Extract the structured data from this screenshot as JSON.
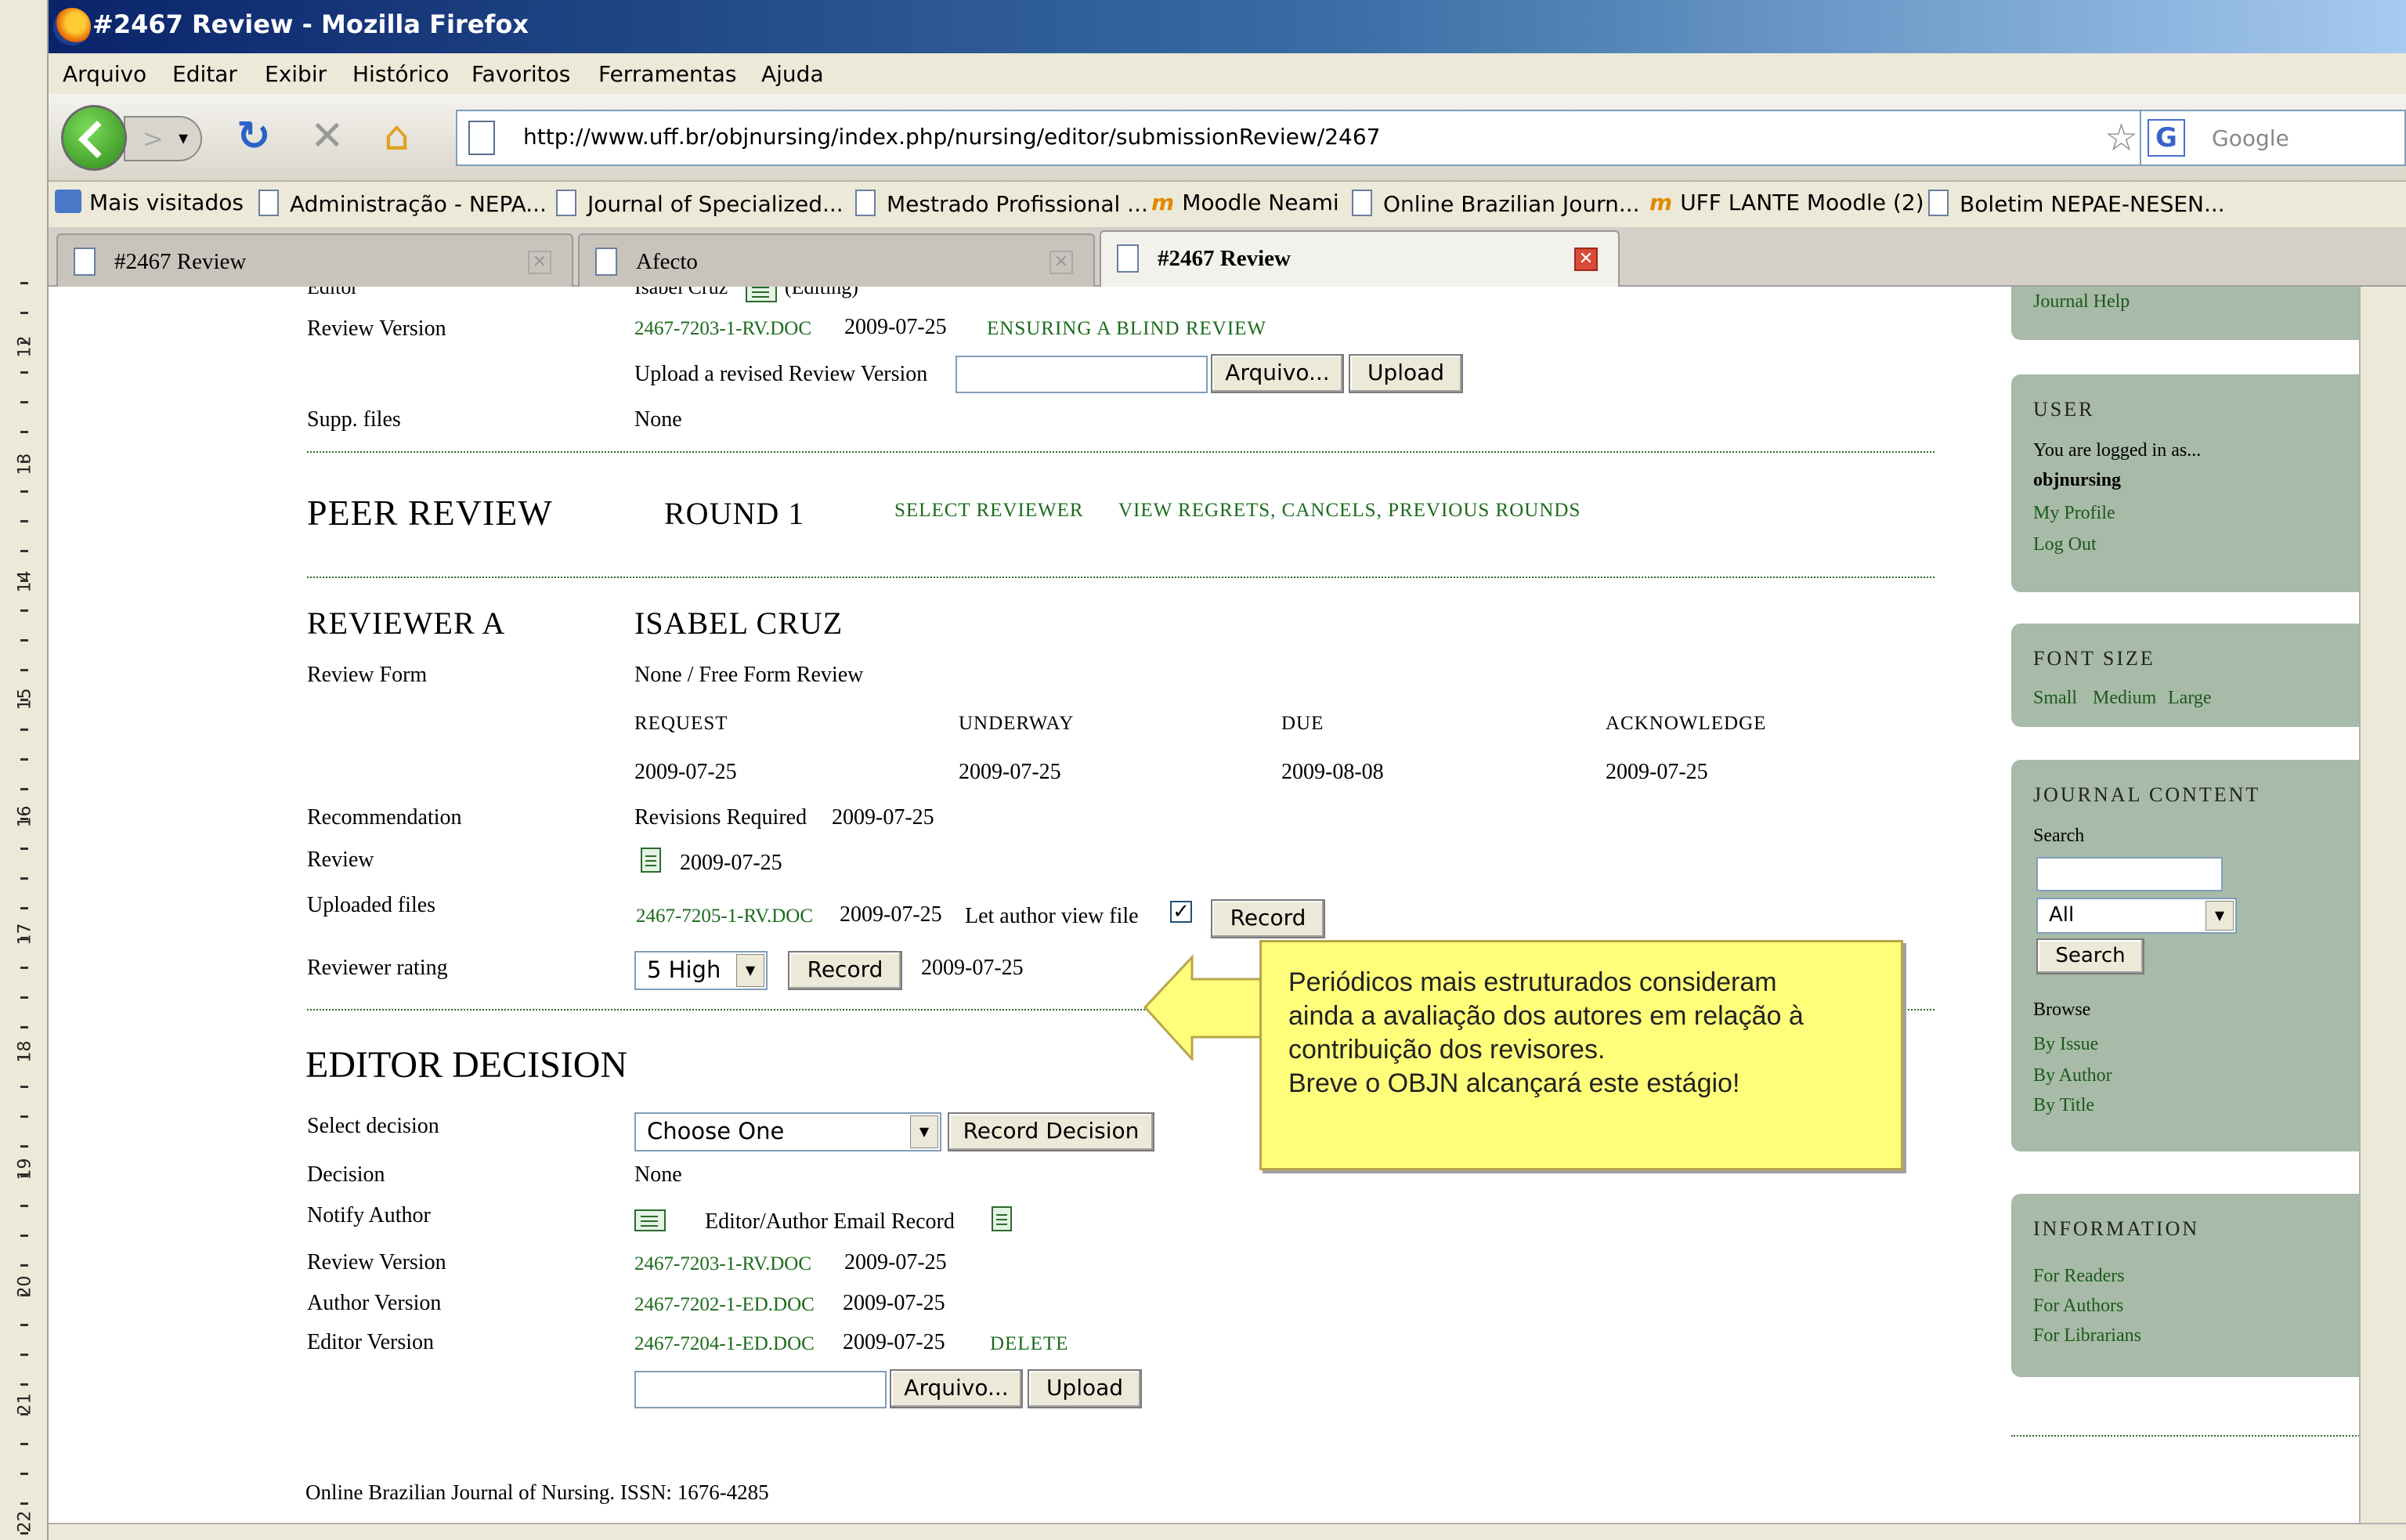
{
  "window": {
    "title": "#2467 Review - Mozilla Firefox"
  },
  "menu": [
    "Arquivo",
    "Editar",
    "Exibir",
    "Histórico",
    "Favoritos",
    "Ferramentas",
    "Ajuda"
  ],
  "nav": {
    "url": "http://www.uff.br/objnursing/index.php/nursing/editor/submissionReview/2467",
    "search_placeholder": "Google"
  },
  "bookmarks": [
    "Mais visitados",
    "Administração - NEPA...",
    "Journal of Specialized...",
    "Mestrado Profissional ...",
    "Moodle Neami",
    "Online Brazilian Journ...",
    "UFF LANTE Moodle (2)",
    "Boletim NEPAE-NESEN..."
  ],
  "tabs": [
    {
      "label": "#2467 Review",
      "active": false
    },
    {
      "label": "Afecto",
      "active": false
    },
    {
      "label": "#2467 Review",
      "active": true
    }
  ],
  "ruler": [
    "12",
    "13",
    "14",
    "15",
    "16",
    "17",
    "18",
    "19",
    "20",
    "21",
    "22"
  ],
  "top_section": {
    "editor_label": "Editor",
    "editor_value": "Isabel Cruz",
    "editor_role": "(Editing)",
    "review_version_label": "Review Version",
    "review_file": "2467-7203-1-RV.DOC",
    "review_date": "2009-07-25",
    "blind_link": "ENSURING A BLIND REVIEW",
    "upload_label": "Upload a revised Review Version",
    "browse_button": "Arquivo...",
    "upload_button": "Upload",
    "supp_label": "Supp. files",
    "supp_value": "None"
  },
  "peer_review": {
    "heading": "PEER REVIEW",
    "round": "ROUND 1",
    "select_reviewer": "SELECT REVIEWER",
    "view_regrets": "VIEW REGRETS, CANCELS, PREVIOUS ROUNDS"
  },
  "reviewer": {
    "heading": "REVIEWER A",
    "name": "ISABEL CRUZ",
    "review_form_label": "Review Form",
    "review_form_value": "None / Free Form Review",
    "columns": [
      "REQUEST",
      "UNDERWAY",
      "DUE",
      "ACKNOWLEDGE"
    ],
    "dates": [
      "2009-07-25",
      "2009-07-25",
      "2009-08-08",
      "2009-07-25"
    ],
    "recommendation_label": "Recommendation",
    "recommendation_value": "Revisions Required",
    "recommendation_date": "2009-07-25",
    "review_label": "Review",
    "review_date": "2009-07-25",
    "uploaded_label": "Uploaded files",
    "uploaded_file": "2467-7205-1-RV.DOC",
    "uploaded_date": "2009-07-25",
    "let_author_view": "Let author view file",
    "record_button": "Record",
    "rating_label": "Reviewer rating",
    "rating_value": "5 High",
    "rating_record_button": "Record",
    "rating_date": "2009-07-25"
  },
  "editor_decision": {
    "heading": "EDITOR DECISION",
    "select_label": "Select decision",
    "select_value": "Choose One",
    "record_button": "Record Decision",
    "decision_label": "Decision",
    "decision_value": "None",
    "notify_label": "Notify Author",
    "notify_text": "Editor/Author Email Record",
    "review_version_label": "Review Version",
    "review_file": "2467-7203-1-RV.DOC",
    "review_date": "2009-07-25",
    "author_version_label": "Author Version",
    "author_file": "2467-7202-1-ED.DOC",
    "author_date": "2009-07-25",
    "editor_version_label": "Editor Version",
    "editor_file": "2467-7204-1-ED.DOC",
    "editor_date": "2009-07-25",
    "delete_link": "DELETE",
    "browse_button": "Arquivo...",
    "upload_button": "Upload"
  },
  "footer": "Online Brazilian Journal of Nursing. ISSN: 1676-4285",
  "callout": {
    "lines": [
      "Periódicos mais estruturados consideram",
      "ainda a avaliação dos autores em relação à",
      "contribuição dos revisores.",
      "Breve o OBJN alcançará este estágio!"
    ]
  },
  "sidebar": {
    "journal_help": "Journal Help",
    "user": {
      "heading": "USER",
      "logged": "You are logged in as...",
      "username": "objnursing",
      "profile": "My Profile",
      "logout": "Log Out"
    },
    "font_size": {
      "heading": "FONT SIZE",
      "small": "Small",
      "medium": "Medium",
      "large": "Large"
    },
    "journal_content": {
      "heading": "JOURNAL CONTENT",
      "search_label": "Search",
      "scope": "All",
      "search_button": "Search",
      "browse": "Browse",
      "by_issue": "By Issue",
      "by_author": "By Author",
      "by_title": "By Title"
    },
    "information": {
      "heading": "INFORMATION",
      "readers": "For Readers",
      "authors": "For Authors",
      "librarians": "For Librarians"
    }
  }
}
